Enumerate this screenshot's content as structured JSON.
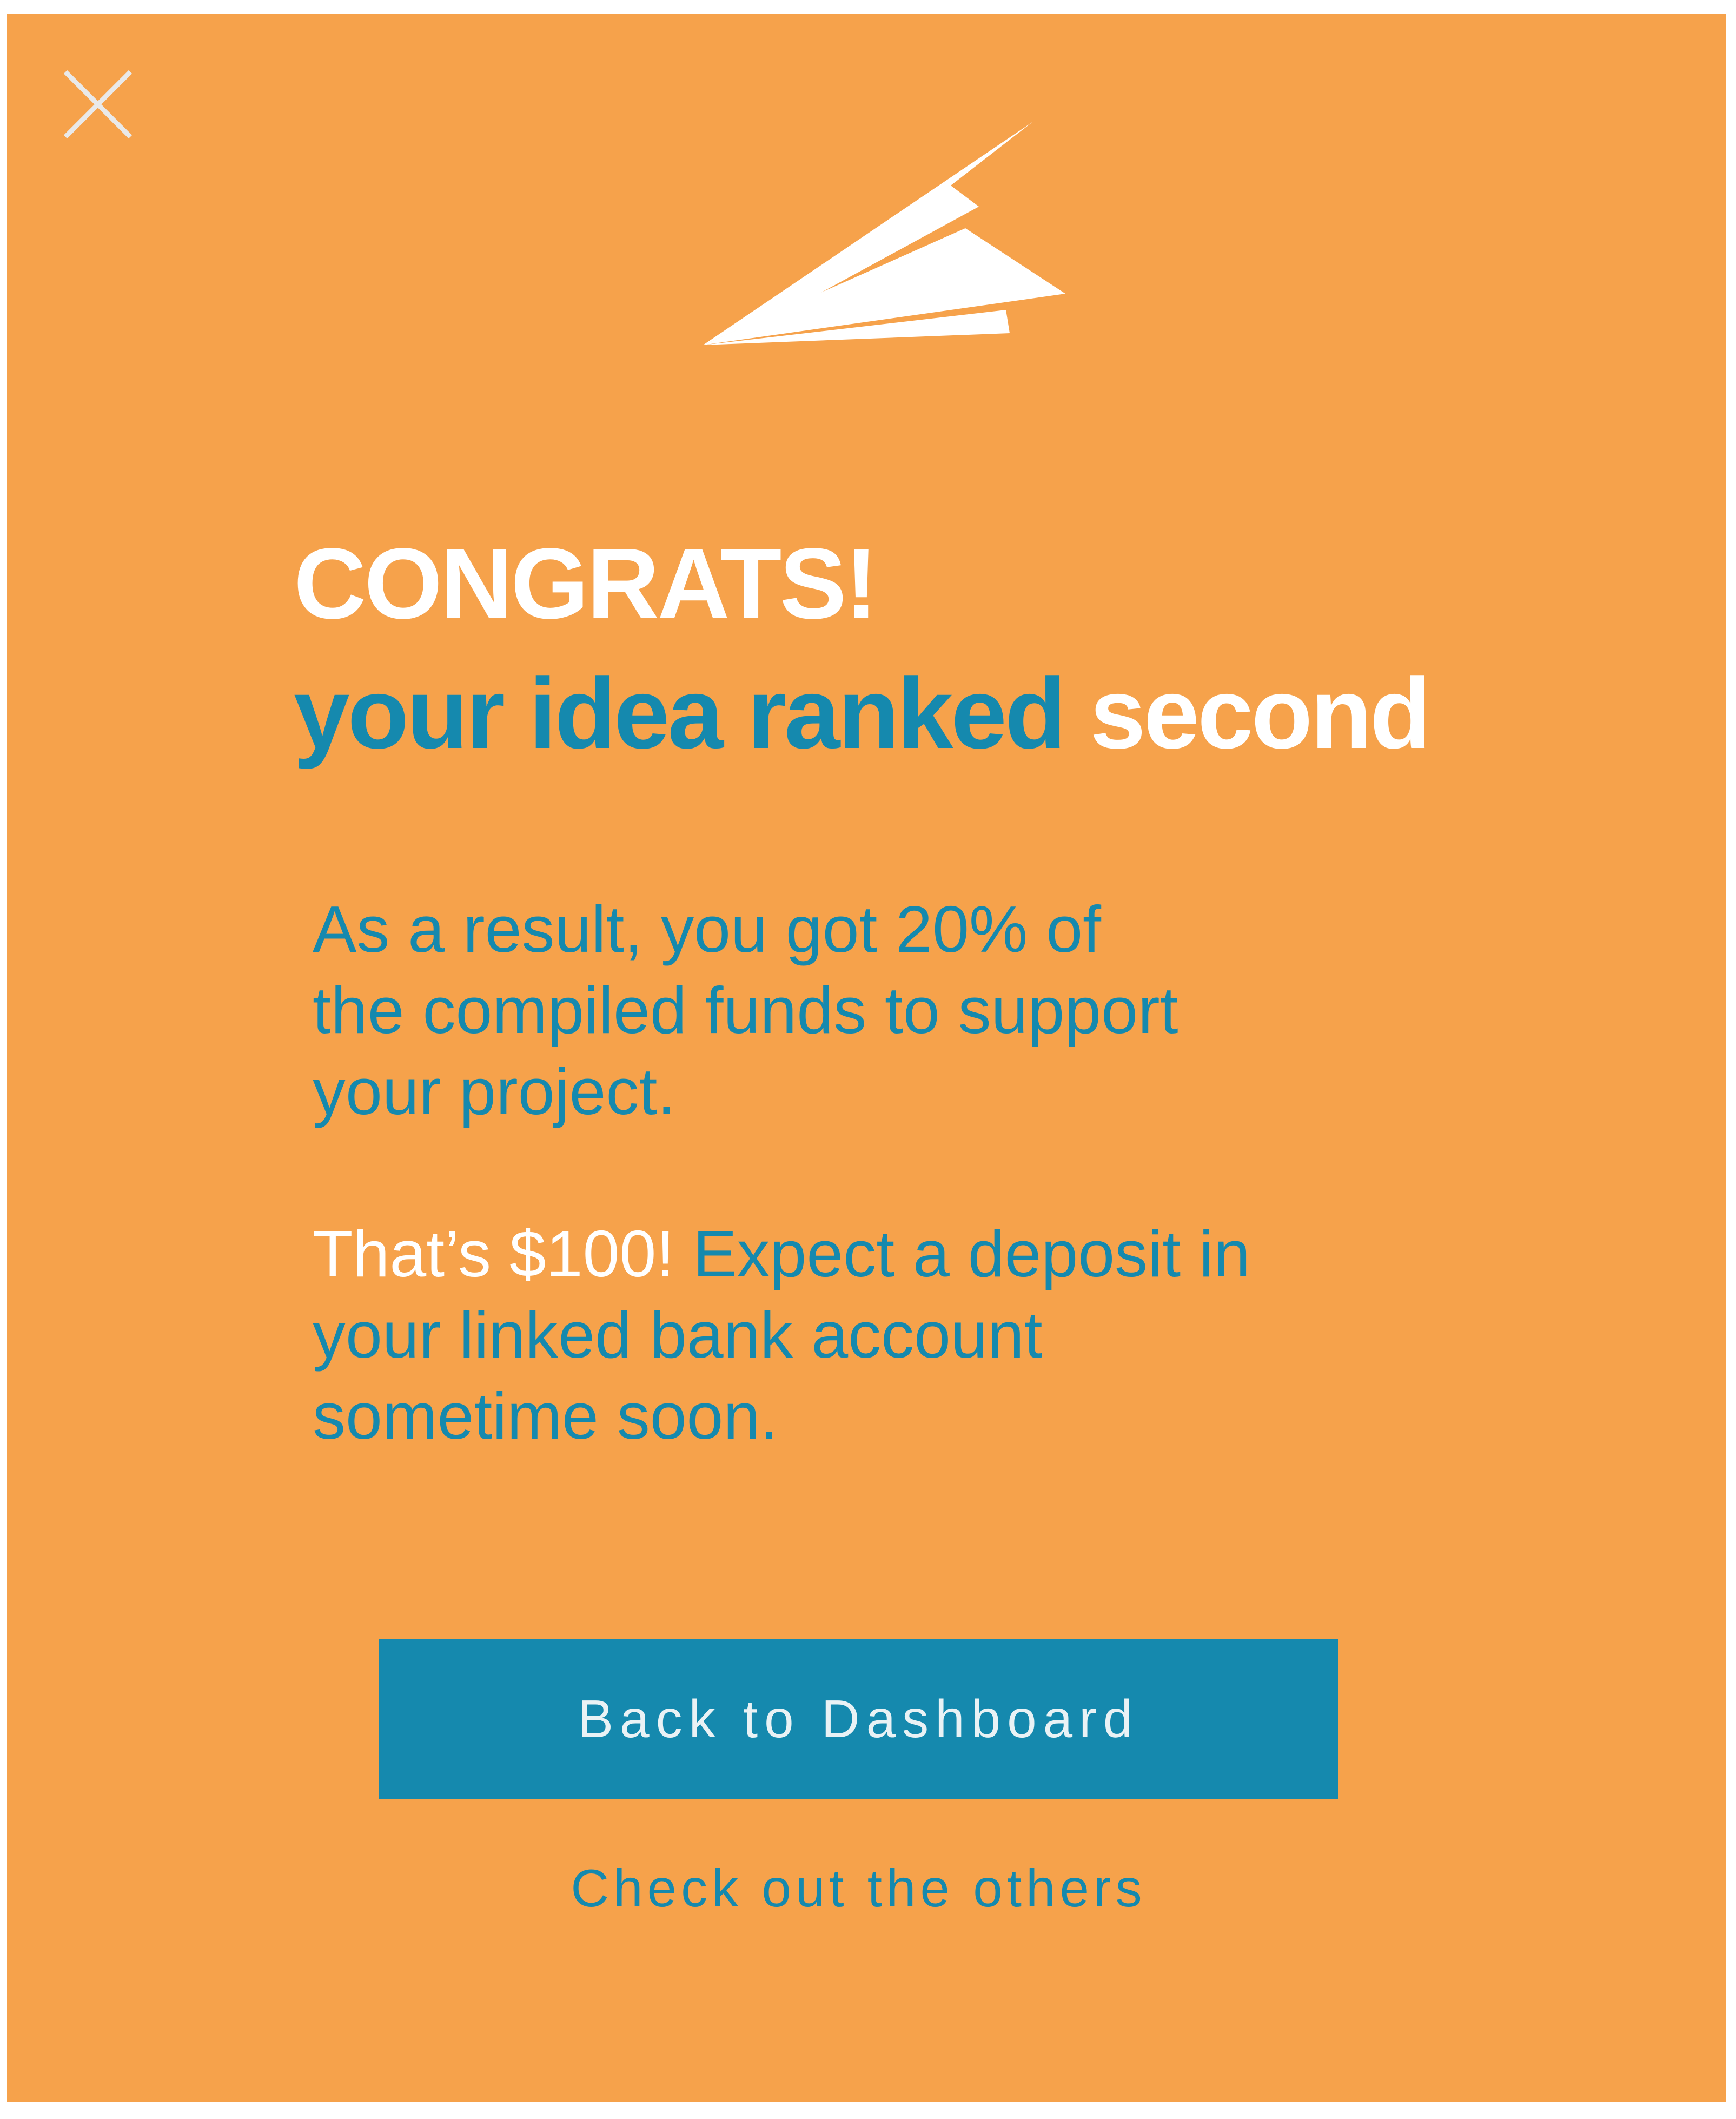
{
  "colors": {
    "background": "#F6A24B",
    "accent": "#1589AE",
    "white": "#FFFFFF",
    "close_icon": "#E9E9E9"
  },
  "icons": {
    "close": "close-icon",
    "logo": "paper-plane-icon"
  },
  "headline": {
    "line1": "CONGRATS!",
    "line2_prefix": "your idea ranked ",
    "line2_highlight": "second"
  },
  "body": {
    "paragraph1": [
      "As a result, you got 20% of",
      "the compiled funds to support",
      "your project."
    ],
    "paragraph2_highlight": "That’s $100!",
    "paragraph2_line1_rest": " Expect a deposit in",
    "paragraph2_lines": [
      "your linked bank account",
      "sometime soon."
    ]
  },
  "actions": {
    "primary_label": "Back to Dashboard",
    "secondary_label": "Check out the others"
  }
}
